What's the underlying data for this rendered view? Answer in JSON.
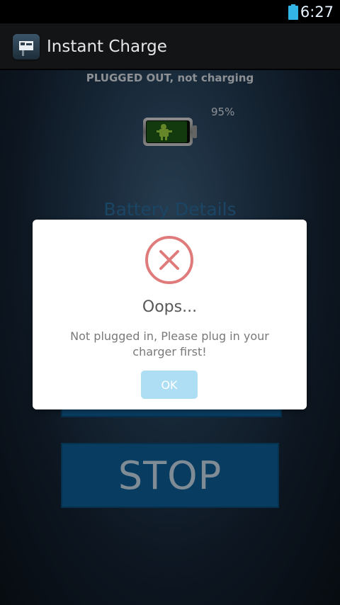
{
  "status_bar": {
    "time": "6:27"
  },
  "header": {
    "title": "Instant Charge"
  },
  "main": {
    "plug_status": "PLUGGED OUT, not charging",
    "battery_percent": "95%",
    "battery_level": 0.95,
    "battery_details_label": "Battery Details",
    "stop_label": "STOP"
  },
  "dialog": {
    "title": "Oops...",
    "message": "Not plugged in, Please plug in your charger first!",
    "ok_label": "OK"
  },
  "colors": {
    "accent": "#0d5f95",
    "error": "#e07b7b",
    "ok_button": "#aedef4",
    "battery_fill": "#1e5a16"
  }
}
